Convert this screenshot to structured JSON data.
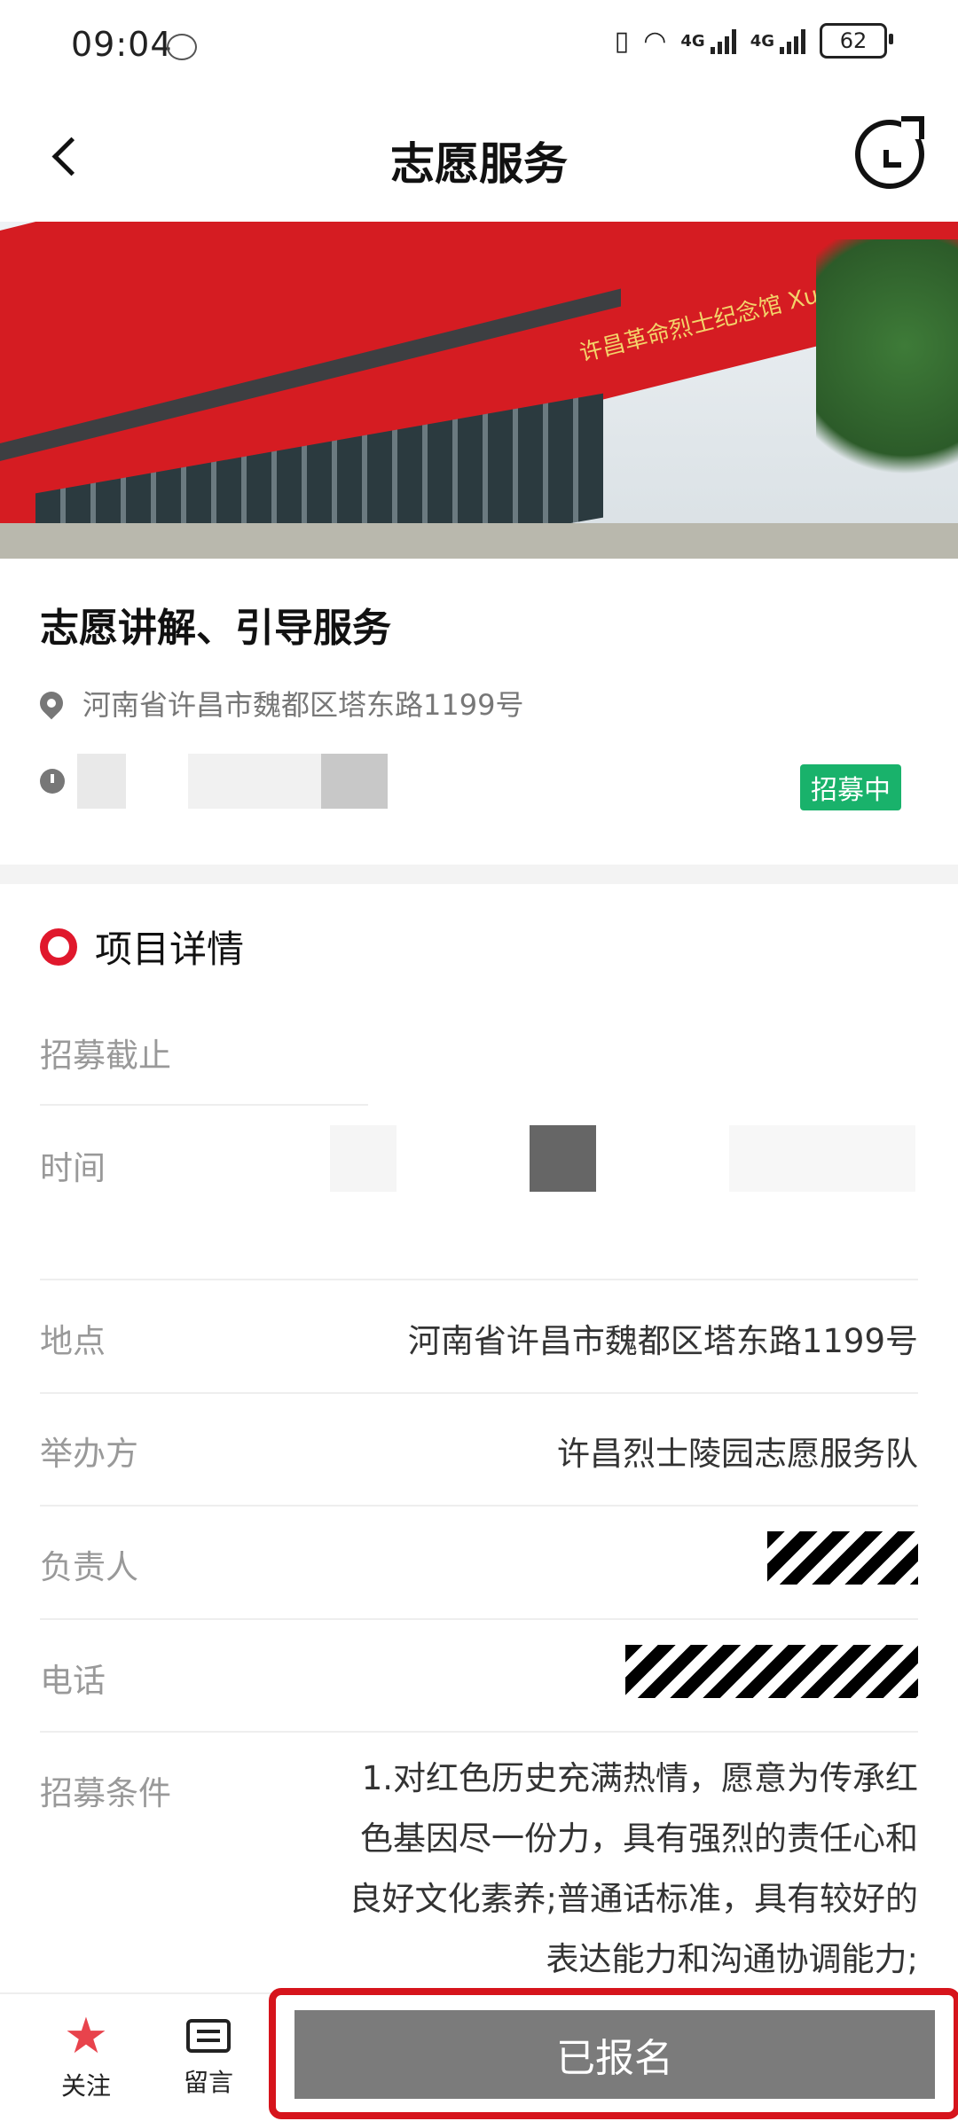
{
  "status_bar": {
    "time": "09:04",
    "network_labels": [
      "4G",
      "4G"
    ],
    "battery": "62"
  },
  "header": {
    "title": "志愿服务"
  },
  "hero": {
    "sign_text": "许昌革命烈士纪念馆 Xuchang Revolutionary Martyrs Memorial Museum"
  },
  "activity": {
    "title": "志愿讲解、引导服务",
    "location": "河南省许昌市魏都区塔东路1199号",
    "status": "招募中"
  },
  "details": {
    "section_title": "项目详情",
    "rows": [
      {
        "label": "招募截止",
        "value": ""
      },
      {
        "label": "时间",
        "value": ""
      },
      {
        "label": "地点",
        "value": "河南省许昌市魏都区塔东路1199号"
      },
      {
        "label": "举办方",
        "value": "许昌烈士陵园志愿服务队"
      },
      {
        "label": "负责人",
        "value": ""
      },
      {
        "label": "电话",
        "value": ""
      },
      {
        "label": "招募条件",
        "value": "1.对红色历史充满热情，愿意为传承红色基因尽一份力，具有强烈的责任心和良好文化素养;普通话标准，具有较好的表达能力和沟通协调能力;"
      }
    ]
  },
  "bottom_bar": {
    "follow_label": "关注",
    "message_label": "留言",
    "signup_label": "已报名"
  },
  "colors": {
    "accent_red": "#e0182c",
    "badge_green": "#19b26b",
    "button_gray": "#7b7b7b"
  },
  "icons": [
    "back-arrow-icon",
    "refresh-icon",
    "location-pin-icon",
    "clock-icon",
    "star-icon",
    "message-icon"
  ]
}
